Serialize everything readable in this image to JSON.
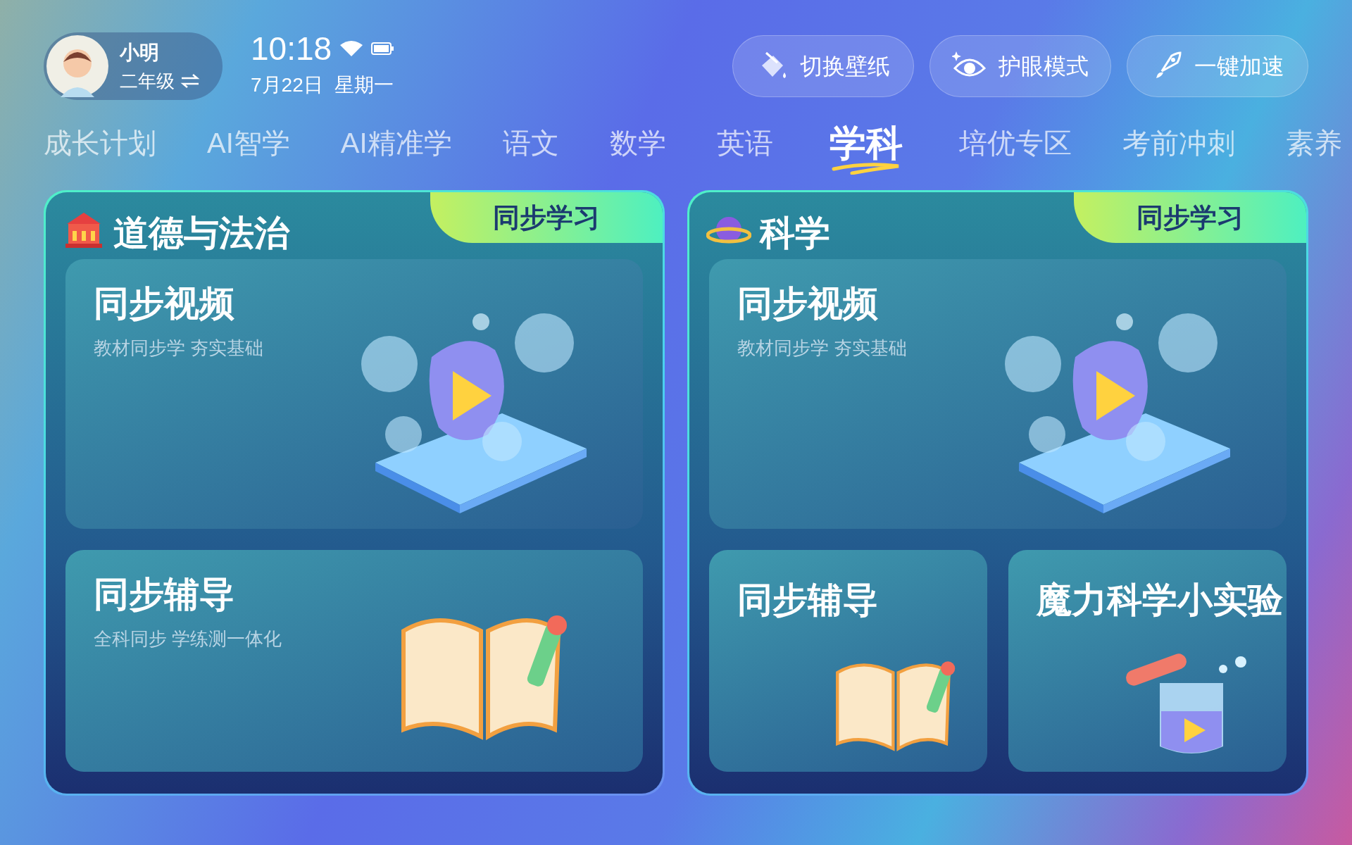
{
  "profile": {
    "name": "小明",
    "grade": "二年级"
  },
  "status": {
    "time": "10:18",
    "date": "7月22日",
    "weekday": "星期一"
  },
  "actions": [
    {
      "label": "切换壁纸",
      "kind": "wallpaper"
    },
    {
      "label": "护眼模式",
      "kind": "eye"
    },
    {
      "label": "一键加速",
      "kind": "boost"
    }
  ],
  "tabs": [
    {
      "label": "成长计划",
      "selected": false
    },
    {
      "label": "AI智学",
      "selected": false
    },
    {
      "label": "AI精准学",
      "selected": false
    },
    {
      "label": "语文",
      "selected": false
    },
    {
      "label": "数学",
      "selected": false
    },
    {
      "label": "英语",
      "selected": false
    },
    {
      "label": "学科",
      "selected": true
    },
    {
      "label": "培优专区",
      "selected": false
    },
    {
      "label": "考前冲刺",
      "selected": false
    },
    {
      "label": "素养",
      "selected": false
    }
  ],
  "subjects": [
    {
      "title": "道德与法治",
      "kind": "civics",
      "badge": "同步学习",
      "cards": [
        {
          "title": "同步视频",
          "subtitle": "教材同步学 夯实基础",
          "kind": "video"
        },
        {
          "title": "同步辅导",
          "subtitle": "全科同步 学练测一体化",
          "kind": "book"
        }
      ]
    },
    {
      "title": "科学",
      "kind": "science",
      "badge": "同步学习",
      "cards": [
        {
          "title": "同步视频",
          "subtitle": "教材同步学 夯实基础",
          "kind": "video"
        },
        {
          "title": "同步辅导",
          "kind": "book"
        },
        {
          "title": "魔力科学小实验",
          "kind": "experiment"
        }
      ]
    }
  ]
}
